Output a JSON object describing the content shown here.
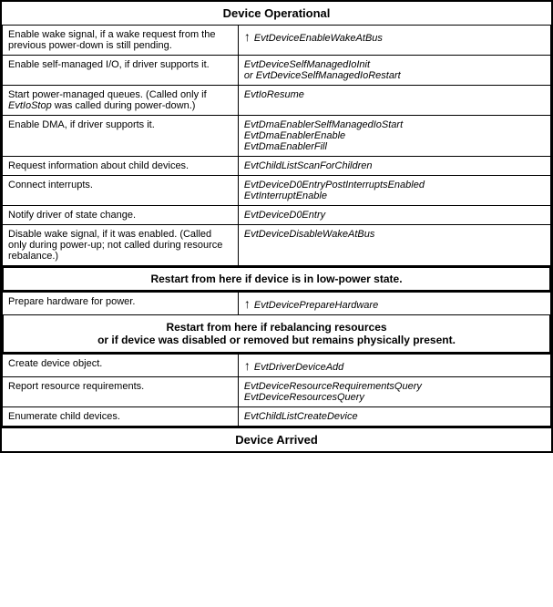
{
  "headers": {
    "device_operational": "Device Operational",
    "device_arrived": "Device Arrived",
    "restart_low_power": "Restart from here if device is in low-power state.",
    "restart_rebalance": "Restart from here if rebalancing resources\nor if device was disabled or removed but remains physically present."
  },
  "rows_top": [
    {
      "description": "Enable wake signal, if a wake request from the previous power-down is still pending.",
      "event": "EvtDeviceEnableWakeAtBus",
      "has_arrow": true
    },
    {
      "description": "Enable self-managed I/O, if driver supports it.",
      "event": "EvtDeviceSelfManagedIoInit\nor EvtDeviceSelfManagedIoRestart",
      "has_arrow": false
    },
    {
      "description": "Start power-managed queues. (Called only if EvtIoStop was called during power-down.)",
      "event": "EvtIoResume",
      "has_arrow": false
    },
    {
      "description": "Enable DMA, if driver supports it.",
      "event": "EvtDmaEnablerSelfManagedIoStart\nEvtDmaEnablerEnable\nEvtDmaEnablerFill",
      "has_arrow": false
    },
    {
      "description": "Request information about child devices.",
      "event": "EvtChildListScanForChildren",
      "has_arrow": false
    },
    {
      "description": "Connect interrupts.",
      "event": "EvtDeviceD0EntryPostInterruptsEnabled\nEvtInterruptEnable",
      "has_arrow": false
    },
    {
      "description": "Notify driver of state change.",
      "event": "EvtDeviceD0Entry",
      "has_arrow": false
    },
    {
      "description": "Disable wake signal, if it was enabled. (Called only during power-up; not called during resource rebalance.)",
      "event": "EvtDeviceDisableWakeAtBus",
      "has_arrow": false
    }
  ],
  "row_prepare": {
    "description": "Prepare hardware for power.",
    "event": "EvtDevicePrepareHardware",
    "has_arrow": true
  },
  "rows_bottom": [
    {
      "description": "Create device object.",
      "event": "EvtDriverDeviceAdd",
      "has_arrow": true
    },
    {
      "description": "Report resource requirements.",
      "event": "EvtDeviceResourceRequirementsQuery\nEvtDeviceResourcesQuery",
      "has_arrow": false
    },
    {
      "description": "Enumerate child devices.",
      "event": "EvtChildListCreateDevice",
      "has_arrow": false
    }
  ]
}
